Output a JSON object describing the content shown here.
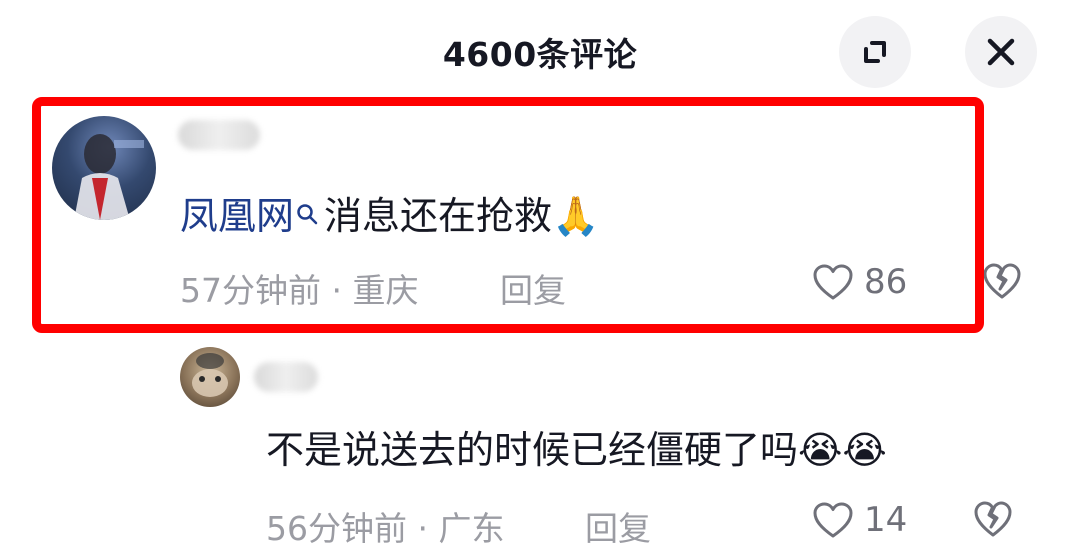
{
  "header": {
    "title": "4600条评论",
    "expand_icon": "expand-icon",
    "close_icon": "close-icon"
  },
  "comments": [
    {
      "mention": "凤凰网",
      "text": "消息还在抢救🙏",
      "time_location": "57分钟前 · 重庆",
      "reply_label": "回复",
      "likes": "86"
    },
    {
      "text": "不是说送去的时候已经僵硬了吗😭😭",
      "time_location": "56分钟前 · 广东",
      "reply_label": "回复",
      "likes": "14"
    }
  ],
  "colors": {
    "highlight": "#ff0000",
    "mention": "#1f3d8c",
    "meta": "#9b9ca3"
  }
}
